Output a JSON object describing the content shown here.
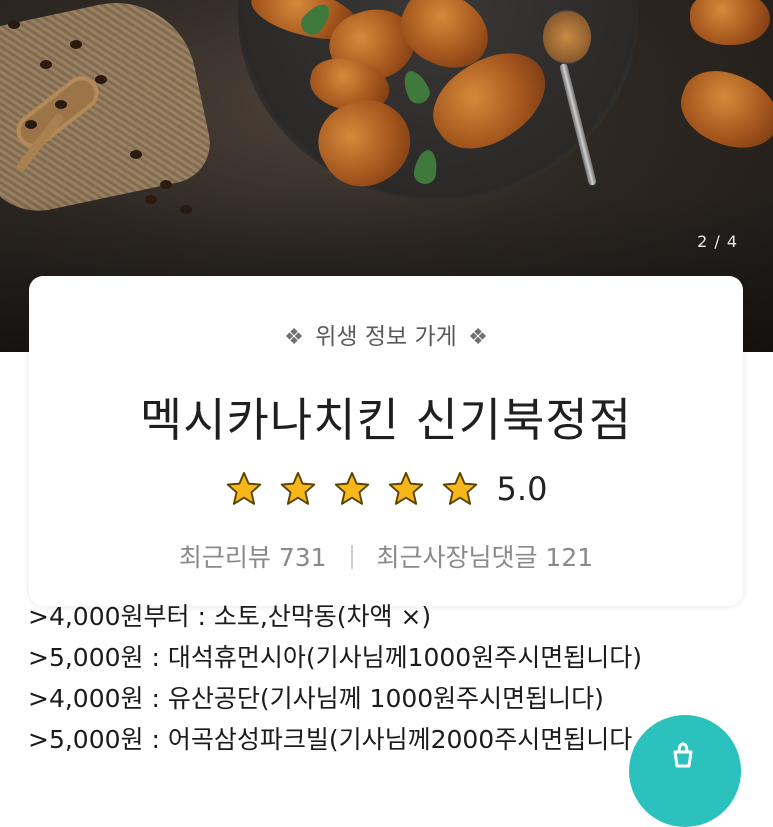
{
  "hero": {
    "pager": "2 / 4"
  },
  "store": {
    "hygiene_badge": "위생 정보 가게",
    "hygiene_ornament": "❖",
    "name": "멕시카나치킨 신기북정점",
    "rating": "5.0",
    "rating_stars": 5,
    "star_color": "#f7b718",
    "recent_reviews_label": "최근리뷰",
    "recent_reviews_count": "731",
    "owner_comments_label": "최근사장님댓글",
    "owner_comments_count": "121"
  },
  "delivery_notes": [
    ">4,000원부터 : 소토,산막동(차액 ×)",
    ">5,000원 : 대석휴먼시아(기사님께1000원주시면됩니다)",
    ">4,000원 : 유산공단(기사님께 1000원주시면됩니다)",
    ">5,000원 : 어곡삼성파크빌(기사님께2000주시면됩니다"
  ],
  "fab": {
    "icon": "cart-icon",
    "color": "#2bc1bd"
  }
}
